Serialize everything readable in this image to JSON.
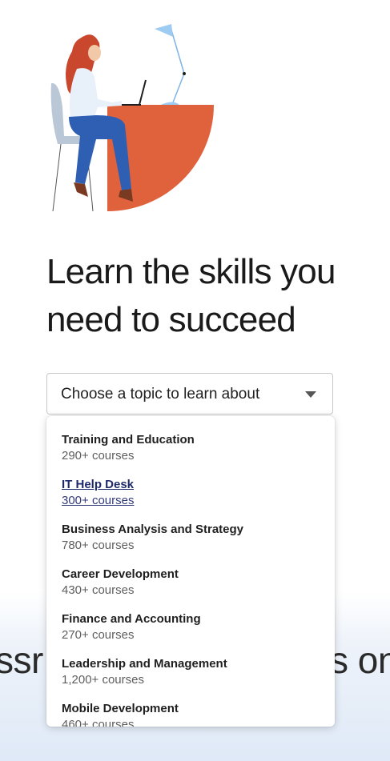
{
  "headline": "Learn the skills you need to succeed",
  "topic_select": {
    "label": "Choose a topic to learn about"
  },
  "topics": [
    {
      "title": "Training and Education",
      "count": "290+ courses"
    },
    {
      "title": "IT Help Desk",
      "count": "300+ courses"
    },
    {
      "title": "Business Analysis and Strategy",
      "count": "780+ courses"
    },
    {
      "title": "Career Development",
      "count": "430+ courses"
    },
    {
      "title": "Finance and Accounting",
      "count": "270+ courses"
    },
    {
      "title": "Leadership and Management",
      "count": "1,200+ courses"
    },
    {
      "title": "Mobile Development",
      "count": "460+ courses"
    }
  ],
  "background_text": {
    "left": "ssr",
    "right": "s on"
  },
  "colors": {
    "desk": "#e0623d",
    "lamp": "#9ecbf2",
    "hair": "#c9472c",
    "pants": "#2f5fb3",
    "chair": "#b9c7d6"
  }
}
